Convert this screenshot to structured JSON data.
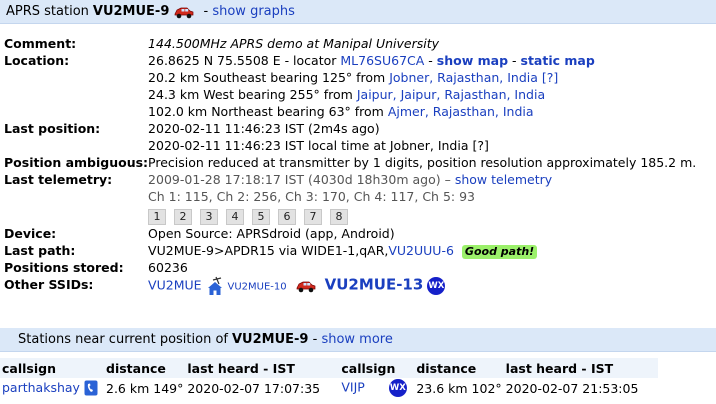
{
  "header": {
    "prefix": "APRS station",
    "callsign": "VU2MUE-9",
    "separator": " - ",
    "show_graphs": "show graphs"
  },
  "rows": {
    "comment": {
      "label": "Comment:",
      "value": "144.500MHz APRS demo at Manipal University"
    },
    "location": {
      "label": "Location:",
      "coords": "26.8625 N 75.5508 E - locator",
      "locator": "ML76SU67CA",
      "dash": " - ",
      "show_map": "show map",
      "dash2": " - ",
      "static_map": "static map",
      "near": [
        {
          "text": "20.2 km Southeast bearing 125° from",
          "place": "Jobner, Rajasthan, India",
          "extra": "[?]"
        },
        {
          "text": "24.3 km West bearing 255° from",
          "place": "Jaipur, Jaipur, Rajasthan, India",
          "extra": ""
        },
        {
          "text": "102.0 km Northeast bearing 63° from",
          "place": "Ajmer, Rajasthan, India",
          "extra": ""
        }
      ]
    },
    "last_position": {
      "label": "Last position:",
      "line1": "2020-02-11 11:46:23 IST (2m4s ago)",
      "line2": "2020-02-11 11:46:23 IST local time at Jobner, India [?]"
    },
    "ambiguous": {
      "label": "Position ambiguous:",
      "value": "Precision reduced at transmitter by 1 digits, position resolution approximately 185.2 m."
    },
    "telemetry": {
      "label": "Last telemetry:",
      "time": "2009-01-28 17:18:17 IST (4030d 18h30m ago) –",
      "show_telemetry": "show telemetry",
      "channels": "Ch 1: 115, Ch 2: 256, Ch 3: 170, Ch 4: 117, Ch 5: 93",
      "buttons": [
        "1",
        "2",
        "3",
        "4",
        "5",
        "6",
        "7",
        "8"
      ]
    },
    "device": {
      "label": "Device:",
      "value": "Open Source: APRSdroid (app, Android)"
    },
    "last_path": {
      "label": "Last path:",
      "value": "VU2MUE-9>APDR15 via WIDE1-1,qAR,",
      "digi": "VU2UUU-6",
      "badge": "Good path!"
    },
    "positions": {
      "label": "Positions stored:",
      "value": "60236"
    },
    "ssids": {
      "label": "Other SSIDs:",
      "items": [
        "VU2MUE",
        "VU2MUE-10",
        "VU2MUE-13"
      ],
      "wx": "WX"
    }
  },
  "near_header": {
    "prefix": "Stations near current position of",
    "callsign": "VU2MUE-9",
    "separator": " - ",
    "show_more": "show more"
  },
  "near_table": {
    "columns": [
      "callsign",
      "distance",
      "last heard - IST",
      "callsign",
      "distance",
      "last heard - IST"
    ],
    "row": {
      "cs1": "parthakshay",
      "dist1": "2.6 km 149°",
      "time1": "2020-02-07 17:07:35",
      "cs2": "VIJP",
      "wx": "WX",
      "dist2": "23.6 km 102°",
      "time2": "2020-02-07 21:53:05"
    }
  },
  "colors": {
    "header_bg": "#dbe8f8",
    "link": "#1a3fbf",
    "good_path": "#9bf06a",
    "wx": "#1520c9"
  }
}
